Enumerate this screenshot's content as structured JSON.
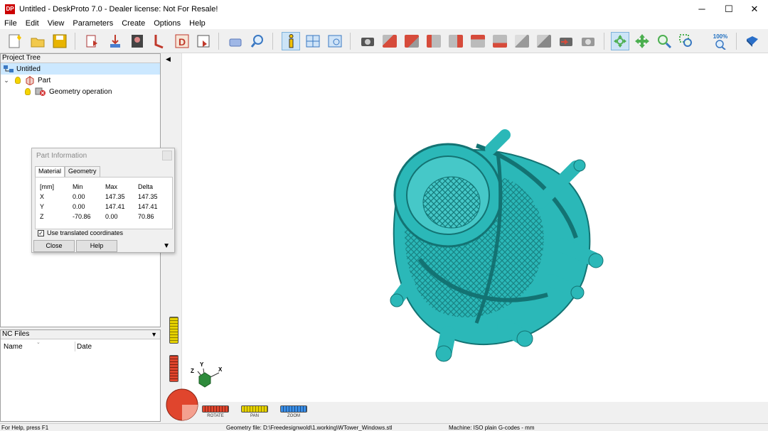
{
  "window": {
    "app_icon": "DP",
    "title": "Untitled - DeskProto 7.0 - Dealer license: Not For Resale!",
    "minimize": "─",
    "maximize": "☐",
    "close": "✕"
  },
  "menu": [
    "File",
    "Edit",
    "View",
    "Parameters",
    "Create",
    "Options",
    "Help"
  ],
  "toolbar": {
    "zoom_label": "100%",
    "icons": [
      "new-icon",
      "open-icon",
      "save-icon",
      "import-icon",
      "export-icon",
      "picture-icon",
      "wire-icon",
      "d-icon",
      "save-as-icon",
      "eraser-icon",
      "find-icon",
      "info-icon",
      "layout-icon",
      "window-icon",
      "camera-icon",
      "view-cube-icons",
      "rotate-icon",
      "pan-icon",
      "zoom-in-icon",
      "zoom-window-icon",
      "zoom-100-icon",
      "book-icon"
    ]
  },
  "project_tree": {
    "header": "Project Tree",
    "root": "Untitled",
    "part": "Part",
    "geometry": "Geometry operation"
  },
  "nc_files": {
    "header": "NC Files",
    "dropdown": "▼",
    "col_name": "Name",
    "col_date": "Date"
  },
  "dialog": {
    "title": "Part Information",
    "tabs": [
      "Material",
      "Geometry"
    ],
    "header_row": [
      "[mm]",
      "Min",
      "Max",
      "Delta"
    ],
    "rows": [
      [
        "X",
        "0.00",
        "147.35",
        "147.35"
      ],
      [
        "Y",
        "0.00",
        "147.41",
        "147.41"
      ],
      [
        "Z",
        "-70.86",
        "0.00",
        "70.86"
      ]
    ],
    "checkbox_label": "Use translated coordinates",
    "checkbox_checked": true,
    "close_label": "Close",
    "help_label": "Help"
  },
  "viewport": {
    "axis_x": "X",
    "axis_y": "Y",
    "axis_z": "Z",
    "model_color": "#2bb8b8",
    "slider_rotate": "ROTATE",
    "slider_pan": "PAN",
    "slider_zoom": "ZOOM"
  },
  "status": {
    "help": "For Help, press F1",
    "geometry_file": "Geometry file: D:\\Freedesignwold\\1.working\\WTower_Windows.stl",
    "machine": "Machine: ISO plain G-codes - mm"
  }
}
